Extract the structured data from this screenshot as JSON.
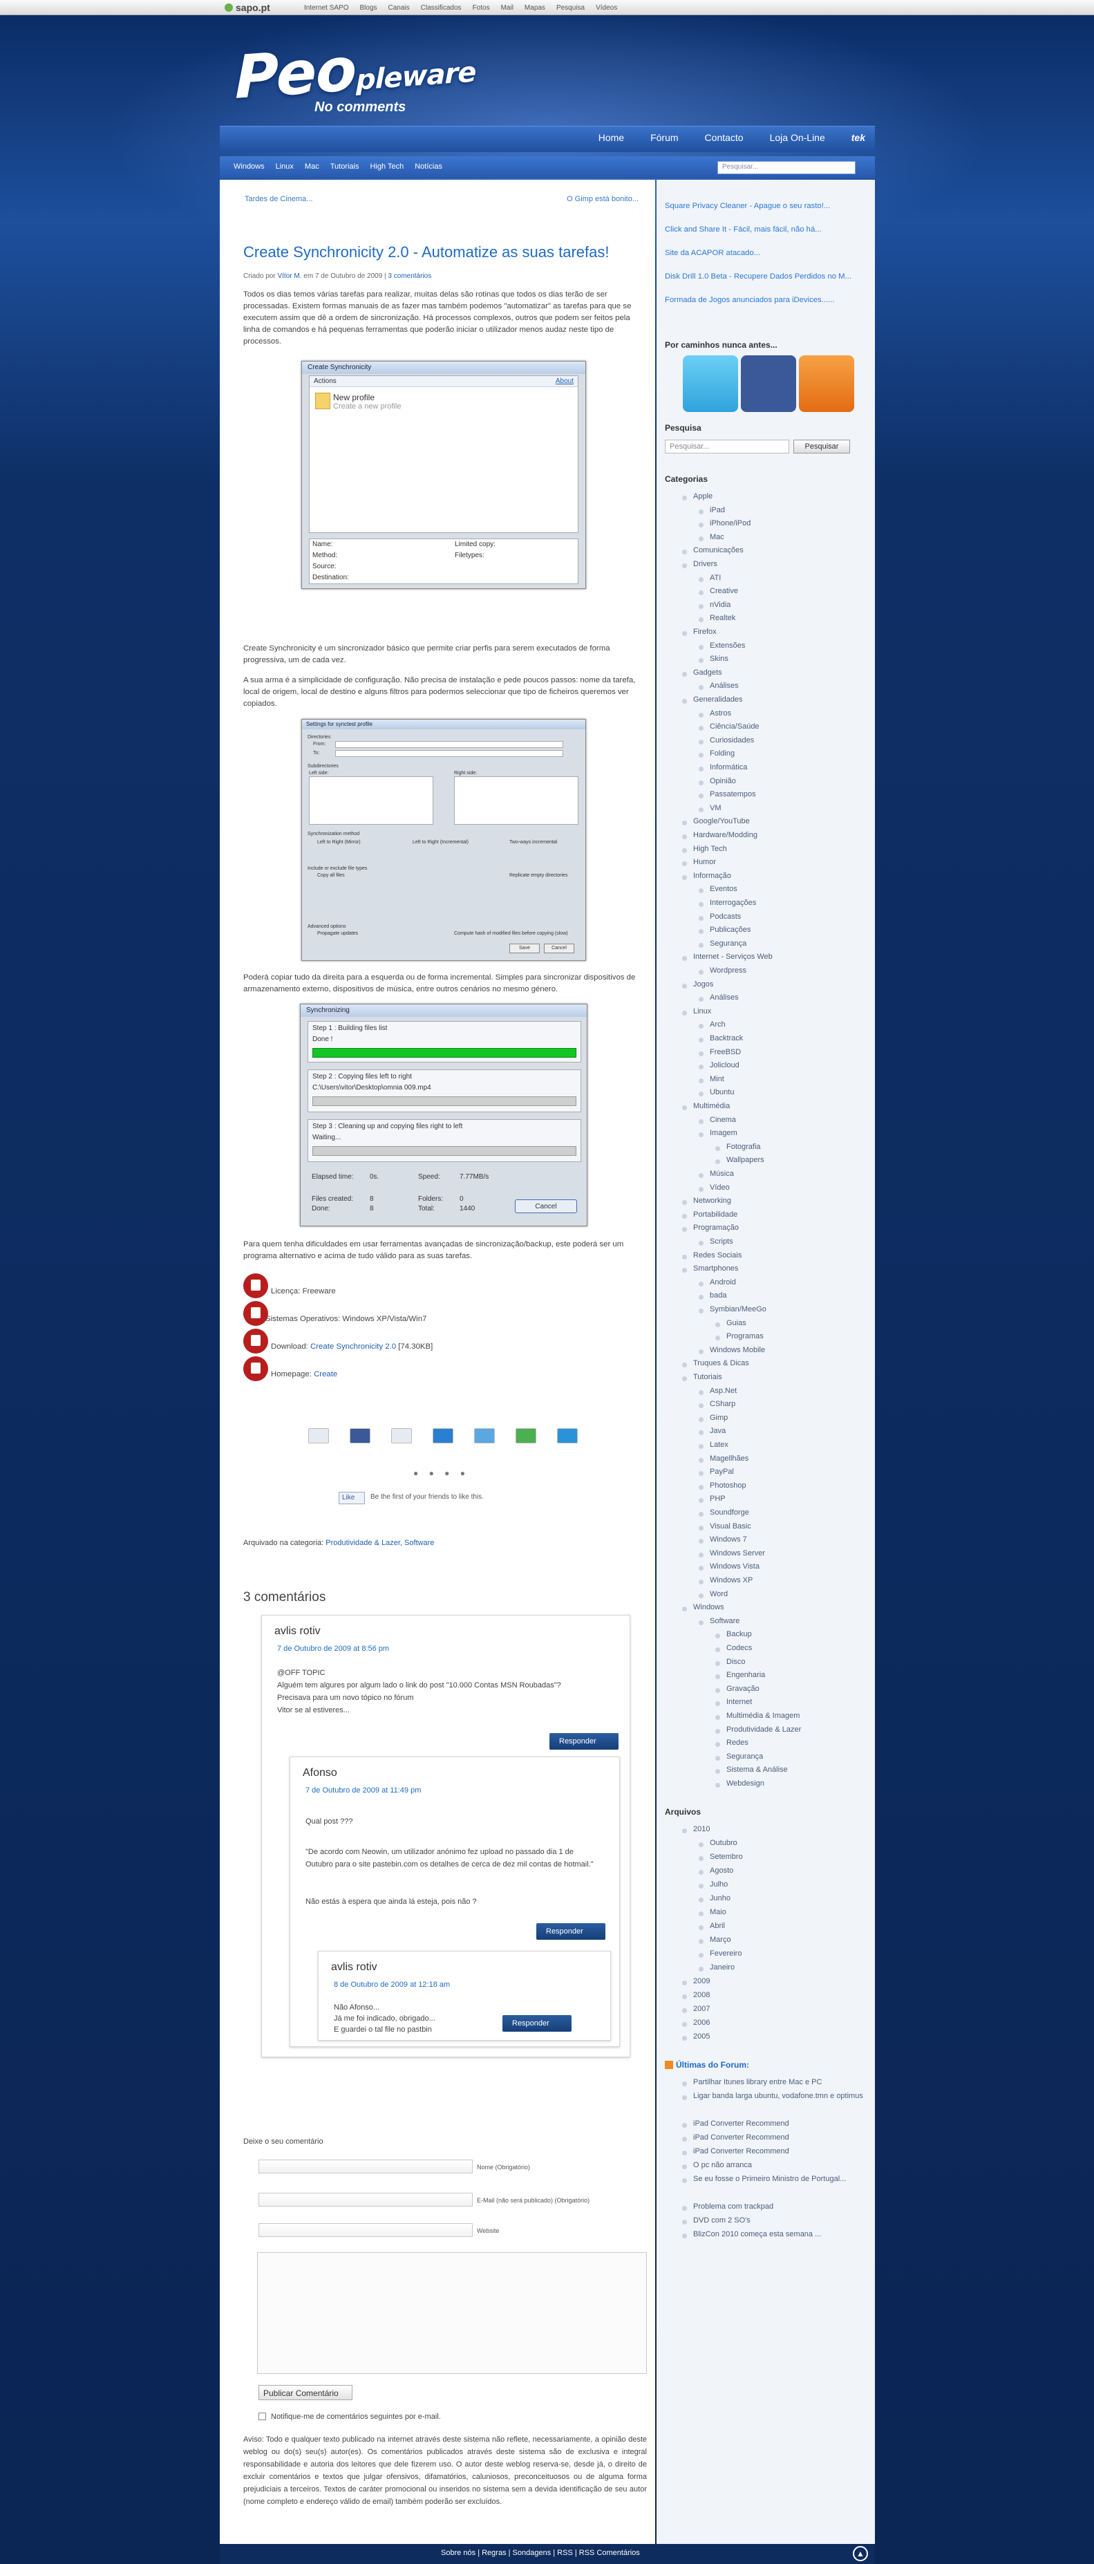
{
  "topbar": {
    "logo": "sapo.pt",
    "links": [
      "Internet SAPO",
      "Blogs",
      "Canais",
      "Classificados",
      "Fotos",
      "Mail",
      "Mapas",
      "Pesquisa",
      "Vídeos"
    ]
  },
  "brand": {
    "title_big": "Peo",
    "title_small": "pleware",
    "tagline": "No comments"
  },
  "mainnav": [
    "Home",
    "Fórum",
    "Contacto",
    "Loja On-Line",
    "tek"
  ],
  "subnav": [
    "Windows",
    "Linux",
    "Mac",
    "Tutoriais",
    "High Tech",
    "Notícias"
  ],
  "search_top_placeholder": "Pesquisar...",
  "prev_link": "Tardes de Cinema...",
  "next_link": "O Gimp está bonito...",
  "post": {
    "title": "Create Synchronicity 2.0 - Automatize as suas tarefas!",
    "meta_prefix": "Criado por",
    "author": "Vítor M.",
    "meta_date": "em 7 de Outubro de 2009 |",
    "comments_link": "3 comentários",
    "p1": "Todos os dias temos várias tarefas para realizar, muitas delas são rotinas que todos os dias terão de ser processadas. Existem formas manuais de as fazer mas também podemos \"automatizar\" as tarefas para que se executem assim que dê a ordem de sincronização. Há processos complexos, outros que podem ser feitos pela linha de comandos e há pequenas ferramentas que poderão iniciar o utilizador menos audaz neste tipo de processos.",
    "p2": "Create Synchronicity é um sincronizador básico que permite criar perfis para serem executados de forma progressiva, um de cada vez.",
    "p3": "A sua arma é a simplicidade de configuração. Não precisa de instalação e pede poucos passos: nome da tarefa, local de origem, local de destino e alguns filtros para podermos seleccionar que tipo de ficheiros queremos ver copiados.",
    "p4": "Poderá copiar tudo da direita para a esquerda ou de forma incremental. Simples para sincronizar dispositivos de armazenamento externo, dispositivos de música, entre outros cenários no mesmo género.",
    "p5": "Para quem tenha dificuldades em usar ferramentas avançadas de sincronização/backup, este poderá ser um programa alternativo e acima de tudo válido para as suas tarefas.",
    "licence": "Licença: Freeware",
    "os": "Sistemas Operativos: Windows XP/Vista/Win7",
    "download_label": "Download:",
    "download_link": "Create Synchronicity 2.0",
    "download_size": "[74.30KB]",
    "homepage_label": "Homepage:",
    "homepage_link": "Create",
    "like": "Like",
    "like_text": "Be the first of your friends to like this.",
    "archived_label": "Arquivado na categoria:",
    "archived_cats": "Produtividade & Lazer, Software"
  },
  "shot1": {
    "title": "Create Synchronicity",
    "actions": "Actions",
    "about": "About",
    "new_profile": "New profile",
    "new_profile_sub": "Create a new profile",
    "rows": [
      "Name:",
      "Method:",
      "Source:",
      "Destination:"
    ],
    "rows2": [
      "Limited copy:",
      "Filetypes:"
    ]
  },
  "shot2": {
    "title": "Settings for synctest profile",
    "directories": "Directories",
    "from": "From:",
    "to": "To:",
    "subdirs": "Subdirectories",
    "left_side": "Left side:",
    "right_side": "Right side:",
    "method": "Synchronization method",
    "m1": "Left to Right (Mirror)",
    "m2": "Left to Right (Incremental)",
    "m3": "Two-ways incremental",
    "opts": "Include or exclude file types",
    "copy_all": "Copy all files",
    "replicate": "Replicate empty directories",
    "adv": "Advanced options",
    "prop": "Propagate updates",
    "hash": "Compute hash of modified files before copying (slow)",
    "save": "Save",
    "cancel": "Cancel"
  },
  "shot3": {
    "title": "Synchronizing",
    "s1": "Step 1 : Building files list",
    "s1b": "Done !",
    "s2": "Step 2 : Copying files left to right",
    "s2b": "C:\\Users\\vitor\\Desktop\\omnia 009.mp4",
    "s3": "Step 3 : Cleaning up and copying files right to left",
    "s3b": "Waiting...",
    "elapsed": "Elapsed time:",
    "elapsed_v": "0s.",
    "speed": "Speed:",
    "speed_v": "7.77MB/s",
    "created": "Files created:",
    "created_v": "8",
    "folders": "Folders:",
    "folders_v": "0",
    "done": "Done:",
    "done_v": "8",
    "total": "Total:",
    "total_v": "1440",
    "cancel": "Cancel"
  },
  "comments": {
    "heading": "3 comentários",
    "c1": {
      "name": "avlis rotiv",
      "date": "7 de Outubro de 2009 at 8:56 pm",
      "l1": "@OFF TOPIC",
      "l2": "Alguém tem algures por algum lado o link do post \"10.000 Contas MSN Roubadas\"?",
      "l3": "Precisava para um novo tópico no fórum",
      "l4": "Vitor se al estiveres..."
    },
    "c2": {
      "name": "Afonso",
      "date": "7 de Outubro de 2009 at 11:49 pm",
      "l1": "Qual post ???",
      "l2": "\"De acordo com Neowin, um utilizador anónimo fez upload no passado dia 1 de Outubro para o site pastebin.com os detalhes de cerca de dez mil contas de hotmail.\"",
      "l3": "Não estás à espera que ainda lá esteja, pois não ?"
    },
    "c3": {
      "name": "avlis rotiv",
      "date": "8 de Outubro de 2009 at 12:18 am",
      "l1": "Não Afonso...",
      "l2": "Já me foi indicado, obrigado...",
      "l3": "E guardei o tal file no pastbin"
    },
    "reply": "Responder"
  },
  "form": {
    "heading": "Deixe o seu comentário",
    "name_label": "Nome (Obrigatório)",
    "email_label": "E-Mail (não será publicado) (Obrigatório)",
    "site_label": "Website",
    "submit": "Publicar Comentário",
    "notify": "Notifique-me de comentários seguintes por e-mail.",
    "notice": "Aviso: Todo e qualquer texto publicado na internet através deste sistema não reflete, necessariamente, a opinião deste weblog ou do(s) seu(s) autor(es). Os comentários publicados através deste sistema são de exclusiva e integral responsabilidade e autoria dos leitores que dele fizerem uso. O autor deste weblog reserva-se, desde já, o direito de excluir comentários e textos que julgar ofensivos, difamatórios, caluniosos, preconceituosos ou de alguma forma prejudiciais a terceiros. Textos de caráter promocional ou inseridos no sistema sem a devida identificação de seu autor (nome completo e endereço válido de email) também poderão ser excluídos."
  },
  "sidebar": {
    "top_links": [
      "Square Privacy Cleaner - Apague o seu rasto!...",
      "Click and Share It - Fácil, mais fácil, não há...",
      "Site da ACAPOR atacado...",
      "Disk Drill 1.0 Beta - Recupere Dados Perdidos no M...",
      "Formada de Jogos anunciados para iDevices......"
    ],
    "follow_heading": "Por caminhos nunca antes...",
    "search_heading": "Pesquisa",
    "search_placeholder": "Pesquisar...",
    "search_button": "Pesquisar",
    "categories_heading": "Categorias",
    "categories": [
      [
        "Apple",
        0
      ],
      [
        "iPad",
        1
      ],
      [
        "iPhone/iPod",
        1
      ],
      [
        "Mac",
        1
      ],
      [
        "Comunicações",
        0
      ],
      [
        "Drivers",
        0
      ],
      [
        "ATI",
        1
      ],
      [
        "Creative",
        1
      ],
      [
        "nVidia",
        1
      ],
      [
        "Realtek",
        1
      ],
      [
        "Firefox",
        0
      ],
      [
        "Extensões",
        1
      ],
      [
        "Skins",
        1
      ],
      [
        "Gadgets",
        0
      ],
      [
        "Análises",
        1
      ],
      [
        "Generalidades",
        0
      ],
      [
        "Astros",
        1
      ],
      [
        "Ciência/Saúde",
        1
      ],
      [
        "Curiosidades",
        1
      ],
      [
        "Folding",
        1
      ],
      [
        "Informática",
        1
      ],
      [
        "Opinião",
        1
      ],
      [
        "Passatempos",
        1
      ],
      [
        "VM",
        1
      ],
      [
        "Google/YouTube",
        0
      ],
      [
        "Hardware/Modding",
        0
      ],
      [
        "High Tech",
        0
      ],
      [
        "Humor",
        0
      ],
      [
        "Informação",
        0
      ],
      [
        "Eventos",
        1
      ],
      [
        "Interrogações",
        1
      ],
      [
        "Podcasts",
        1
      ],
      [
        "Publicações",
        1
      ],
      [
        "Segurança",
        1
      ],
      [
        "Internet - Serviços Web",
        0
      ],
      [
        "Wordpress",
        1
      ],
      [
        "Jogos",
        0
      ],
      [
        "Análises",
        1
      ],
      [
        "Linux",
        0
      ],
      [
        "Arch",
        1
      ],
      [
        "Backtrack",
        1
      ],
      [
        "FreeBSD",
        1
      ],
      [
        "Jolicloud",
        1
      ],
      [
        "Mint",
        1
      ],
      [
        "Ubuntu",
        1
      ],
      [
        "Multimédia",
        0
      ],
      [
        "Cinema",
        1
      ],
      [
        "Imagem",
        1
      ],
      [
        "Fotografia",
        2
      ],
      [
        "Wallpapers",
        2
      ],
      [
        "Música",
        1
      ],
      [
        "Vídeo",
        1
      ],
      [
        "Networking",
        0
      ],
      [
        "Portabilidade",
        0
      ],
      [
        "Programação",
        0
      ],
      [
        "Scripts",
        1
      ],
      [
        "Redes Sociais",
        0
      ],
      [
        "Smartphones",
        0
      ],
      [
        "Android",
        1
      ],
      [
        "bada",
        1
      ],
      [
        "Symbian/MeeGo",
        1
      ],
      [
        "Guias",
        2
      ],
      [
        "Programas",
        2
      ],
      [
        "Windows Mobile",
        1
      ],
      [
        "Truques & Dicas",
        0
      ],
      [
        "Tutoriais",
        0
      ],
      [
        "Asp.Net",
        1
      ],
      [
        "CSharp",
        1
      ],
      [
        "Gimp",
        1
      ],
      [
        "Java",
        1
      ],
      [
        "Latex",
        1
      ],
      [
        "Magellhães",
        1
      ],
      [
        "PayPal",
        1
      ],
      [
        "Photoshop",
        1
      ],
      [
        "PHP",
        1
      ],
      [
        "Soundforge",
        1
      ],
      [
        "Visual Basic",
        1
      ],
      [
        "Windows 7",
        1
      ],
      [
        "Windows Server",
        1
      ],
      [
        "Windows Vista",
        1
      ],
      [
        "Windows XP",
        1
      ],
      [
        "Word",
        1
      ],
      [
        "Windows",
        0
      ],
      [
        "Software",
        1
      ],
      [
        "Backup",
        2
      ],
      [
        "Codecs",
        2
      ],
      [
        "Disco",
        2
      ],
      [
        "Engenharia",
        2
      ],
      [
        "Gravação",
        2
      ],
      [
        "Internet",
        2
      ],
      [
        "Multimédia & Imagem",
        2
      ],
      [
        "Produtividade & Lazer",
        2
      ],
      [
        "Redes",
        2
      ],
      [
        "Segurança",
        2
      ],
      [
        "Sistema & Análise",
        2
      ],
      [
        "Webdesign",
        2
      ]
    ],
    "archive_heading": "Arquivos",
    "archive": [
      [
        "2010",
        0
      ],
      [
        "Outubro",
        1
      ],
      [
        "Setembro",
        1
      ],
      [
        "Agosto",
        1
      ],
      [
        "Julho",
        1
      ],
      [
        "Junho",
        1
      ],
      [
        "Maio",
        1
      ],
      [
        "Abril",
        1
      ],
      [
        "Março",
        1
      ],
      [
        "Fevereiro",
        1
      ],
      [
        "Janeiro",
        1
      ],
      [
        "2009",
        0
      ],
      [
        "2008",
        0
      ],
      [
        "2007",
        0
      ],
      [
        "2006",
        0
      ],
      [
        "2005",
        0
      ]
    ],
    "forum_heading": "Últimas do Forum:",
    "forum": [
      "Partilhar Itunes library entre Mac e PC",
      "Ligar banda larga ubuntu, vodafone.tmn e optimus",
      "iPad Converter Recommend",
      "iPad Converter Recommend",
      "iPad Converter Recommend",
      "O pc não arranca",
      "Se eu fosse o Primeiro Ministro de Portugal...",
      "Problema com trackpad",
      "DVD com 2 SO's",
      "BlizCon 2010 começa esta semana ..."
    ]
  },
  "footer": "Sobre nós | Regras | Sondagens | RSS | RSS Comentários",
  "colors": {
    "accent": "#1e6ac6",
    "bg_dark": "#0d2a5c",
    "nav": "#2859ad",
    "reply_btn": "#1d4a86"
  }
}
